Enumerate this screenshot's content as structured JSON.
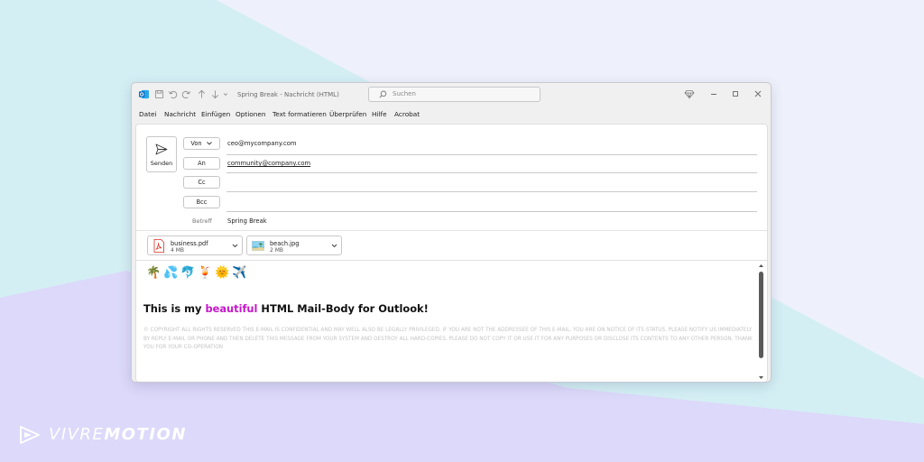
{
  "brand": {
    "logo_light": "VIVRE",
    "logo_bold": "MOTION"
  },
  "window": {
    "title": "Spring Break  -  Nachricht (HTML)",
    "search_placeholder": "Suchen"
  },
  "menu": [
    "Datei",
    "Nachricht",
    "Einfügen",
    "Optionen",
    "Text formatieren",
    "Überprüfen",
    "Hilfe",
    "Acrobat"
  ],
  "compose": {
    "send_label": "Senden",
    "from_label": "Von",
    "from_value": "ceo@mycompany.com",
    "to_label": "An",
    "to_value": "community@company.com",
    "cc_label": "Cc",
    "bcc_label": "Bcc",
    "subject_label": "Betreff",
    "subject_value": "Spring Break"
  },
  "attachments": [
    {
      "name": "business.pdf",
      "size": "4 MB",
      "icon": "pdf-icon"
    },
    {
      "name": "beach.jpg",
      "size": "2 MB",
      "icon": "image-icon"
    }
  ],
  "body": {
    "emojis": [
      "🌴",
      "💦",
      "🐬",
      "🍹",
      "🌞",
      "✈️"
    ],
    "headline_pre": "This is my ",
    "headline_highlight": "beautiful",
    "headline_post": " HTML Mail-Body for Outlook!",
    "legal": "© COPYRIGHT ALL RIGHTS RESERVED THIS E-MAIL IS CONFIDENTIAL AND MAY WELL ALSO BE LEGALLY PRIVILEGED. IF YOU ARE NOT THE ADDRESSEE OF THIS E-MAIL, YOU ARE ON NOTICE OF ITS STATUS. PLEASE NOTIFY US IMMEDIATELY BY REPLY E-MAIL OR PHONE AND THEN DELETE THIS MESSAGE FROM YOUR SYSTEM AND DESTROY ALL HARD-COPIES. PLEASE DO NOT COPY IT OR USE IT FOR ANY PURPOSES OR DISCLOSE ITS CONTENTS TO ANY OTHER PERSON. THANK YOU FOR YOUR CO-OPERATION",
    "highlight_color": "#c617c9"
  },
  "colors": {
    "outlook_blue": "#0f6cbd",
    "pdf_red": "#d93025"
  }
}
